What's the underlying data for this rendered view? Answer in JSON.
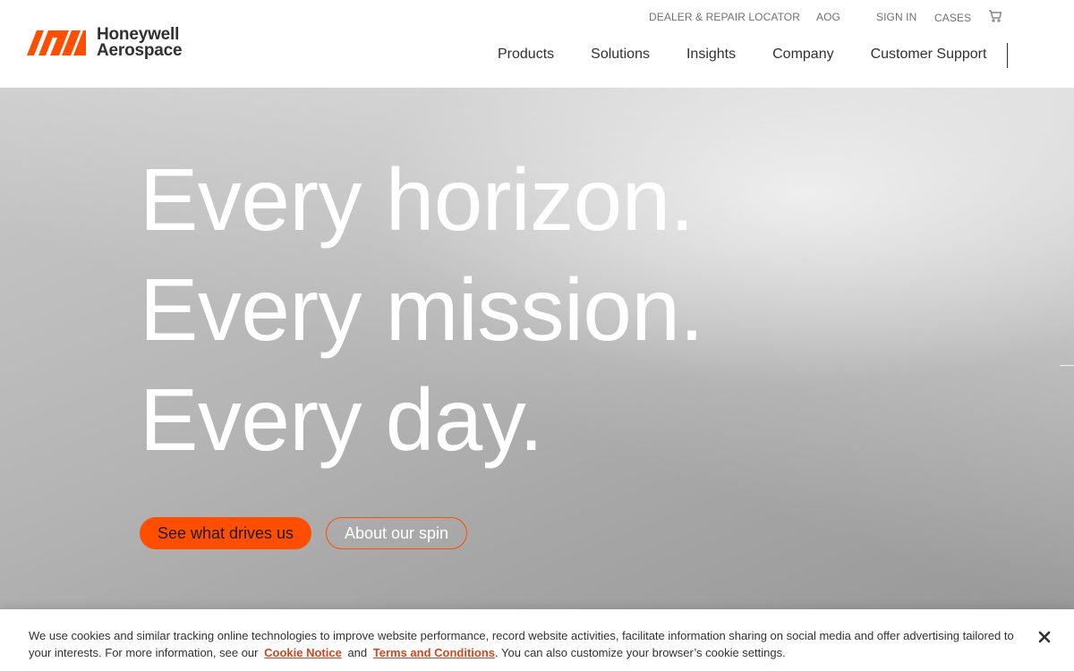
{
  "brand": {
    "name_line1": "Honeywell",
    "name_line2": "Aerospace",
    "accent_color": "#ff4e00"
  },
  "utility_nav": {
    "dealer_locator": "DEALER & REPAIR LOCATOR",
    "aog": "AOG",
    "sign_in": "SIGN IN",
    "cases": "CASES",
    "cart_icon": "cart-icon"
  },
  "main_nav": {
    "items": [
      {
        "label": "Products"
      },
      {
        "label": "Solutions"
      },
      {
        "label": "Insights"
      },
      {
        "label": "Company"
      },
      {
        "label": "Customer Support"
      }
    ]
  },
  "hero": {
    "headline": [
      "Every horizon.",
      "Every mission.",
      "Every day."
    ],
    "primary_cta": "See what drives us",
    "secondary_cta": "About our spin"
  },
  "cookie_banner": {
    "text_before": "We use cookies and similar tracking online technologies to improve website performance, record website activities, facilitate information sharing on social media and offer advertising tailored to your interests. For more information, see our",
    "cookie_notice": "Cookie Notice",
    "and": "and",
    "terms": "Terms and Conditions",
    "text_after": ". You can also customize your browser’s cookie settings.",
    "close_icon": "close-icon"
  }
}
